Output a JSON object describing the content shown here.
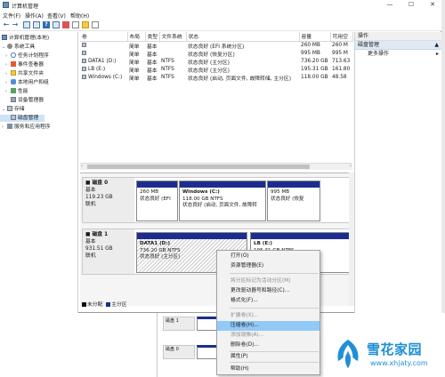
{
  "window": {
    "title": "计算机管理",
    "minimize": "—",
    "maximize": "☐",
    "close": "✕"
  },
  "menu": [
    "文件(F)",
    "操作(A)",
    "查看(V)",
    "帮助(H)"
  ],
  "toolbar": {
    "icons": [
      "back-arrow-icon",
      "forward-arrow-icon",
      "console-tree-icon",
      "properties-icon",
      "help-icon",
      "connect-icon",
      "refresh-icon",
      "export-icon",
      "disk-icon"
    ]
  },
  "tree": {
    "root": "计算机管理(本地)",
    "system_tools": "系统工具",
    "task_scheduler": "任务计划程序",
    "event_viewer": "事件查看器",
    "shared_folders": "共享文件夹",
    "local_users": "本地用户和组",
    "performance": "性能",
    "device_manager": "设备管理器",
    "storage": "存储",
    "disk_management": "磁盘管理",
    "services": "服务和应用程序"
  },
  "volume_table": {
    "headers": [
      "卷",
      "布局",
      "类型",
      "文件系统",
      "状态",
      "容量",
      "可用空"
    ],
    "rows": [
      [
        "",
        "简单",
        "基本",
        "",
        "状态良好 (EFI 系统分区)",
        "260 MB",
        "260 M"
      ],
      [
        "",
        "简单",
        "基本",
        "",
        "状态良好 (恢复分区)",
        "995 MB",
        "995 M"
      ],
      [
        "DATA1 (D:)",
        "简单",
        "基本",
        "NTFS",
        "状态良好 (主分区)",
        "736.20 GB",
        "713.63"
      ],
      [
        "LB (E:)",
        "简单",
        "基本",
        "NTFS",
        "状态良好 (主分区)",
        "195.31 GB",
        "161.80"
      ],
      [
        "Windows (C:)",
        "简单",
        "基本",
        "NTFS",
        "状态良好 (启动, 页面文件, 故障转储, 主分区)",
        "118.00 GB",
        "48.58"
      ]
    ]
  },
  "disks": [
    {
      "name": "磁盘 0",
      "type": "基本",
      "size": "119.23 GB",
      "status": "联机",
      "partitions": [
        {
          "title": "",
          "size": "260 MB",
          "status": "状态良好 (EFI"
        },
        {
          "title": "Windows (C:)",
          "size": "118.00 GB NTFS",
          "status": "状态良好 (启动, 页面文件, 故障转"
        },
        {
          "title": "",
          "size": "995 MB",
          "status": "状态良好 (恢复"
        }
      ]
    },
    {
      "name": "磁盘 1",
      "type": "基本",
      "size": "931.51 GB",
      "status": "联机",
      "partitions": [
        {
          "title": "DATA1 (D:)",
          "size": "736.20 GB NTFS",
          "status": "状态良好 (主分区)"
        },
        {
          "title": "LB (E:)",
          "size": "195.31 GB NTFS",
          "status": ""
        }
      ]
    }
  ],
  "legend": {
    "unallocated": "未分配",
    "primary": "主分区",
    "unallocated_color": "#111111",
    "primary_color": "#1c2d8f"
  },
  "actions": {
    "header": "操作",
    "section": "磁盘管理",
    "more": "更多操作"
  },
  "context_menu": {
    "items": [
      {
        "label": "打开(O)",
        "disabled": false
      },
      {
        "label": "资源管理器(E)",
        "disabled": false
      },
      {
        "label": "将分区标记为活动分区(M)",
        "disabled": true
      },
      {
        "label": "更改驱动器号和路径(C)...",
        "disabled": false
      },
      {
        "label": "格式化(F)...",
        "disabled": false
      },
      {
        "label": "扩展卷(X)...",
        "disabled": true
      },
      {
        "label": "压缩卷(H)...",
        "disabled": false,
        "highlighted": true
      },
      {
        "label": "添加镜像(A)...",
        "disabled": true
      },
      {
        "label": "删除卷(D)...",
        "disabled": false
      },
      {
        "label": "属性(P)",
        "disabled": false
      },
      {
        "label": "帮助(H)",
        "disabled": false
      }
    ]
  },
  "background_window": {
    "rows": [
      "磁盘 1",
      "磁盘 0"
    ]
  },
  "watermark": {
    "title": "雪花家园",
    "url": "www.xhjaty.com"
  },
  "colors": {
    "primary_band": "#1c2d8f",
    "selection": "#cde4f7",
    "menu_highlight": "#91c9f7",
    "watermark": "#1f8fd6"
  }
}
